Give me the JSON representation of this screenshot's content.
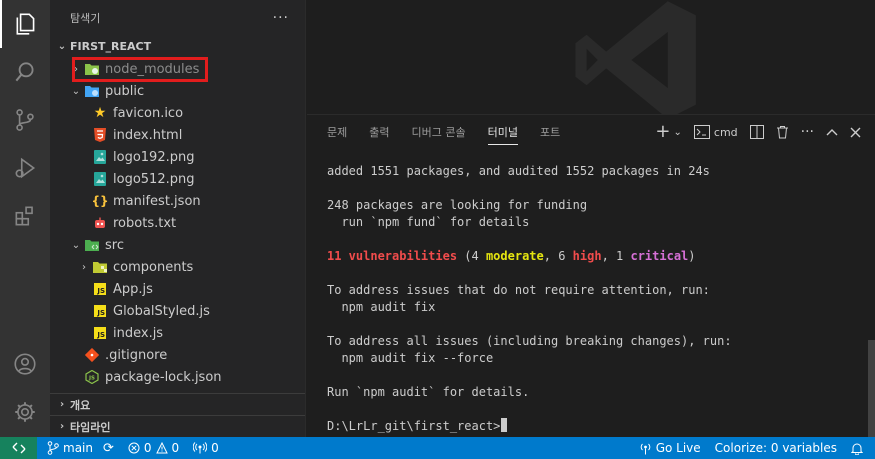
{
  "sidebar": {
    "title": "탐색기",
    "more_label": "···",
    "project": "FIRST_REACT",
    "tree": [
      {
        "label": "node_modules",
        "type": "folder",
        "icon": "node-folder-icon",
        "indent": 0,
        "chevron": "›",
        "top": 0
      },
      {
        "label": "public",
        "type": "folder",
        "icon": "public-folder-icon",
        "indent": 0,
        "chevron": "⌄"
      },
      {
        "label": "favicon.ico",
        "type": "file",
        "icon": "star-icon",
        "indent": 1
      },
      {
        "label": "index.html",
        "type": "file",
        "icon": "html5-icon",
        "indent": 1
      },
      {
        "label": "logo192.png",
        "type": "file",
        "icon": "image-icon",
        "indent": 1
      },
      {
        "label": "logo512.png",
        "type": "file",
        "icon": "image-icon",
        "indent": 1
      },
      {
        "label": "manifest.json",
        "type": "file",
        "icon": "json-icon",
        "indent": 1
      },
      {
        "label": "robots.txt",
        "type": "file",
        "icon": "robot-icon",
        "indent": 1
      },
      {
        "label": "src",
        "type": "folder",
        "icon": "src-folder-icon",
        "indent": 0,
        "chevron": "⌄"
      },
      {
        "label": "components",
        "type": "folder",
        "icon": "components-folder-icon",
        "indent": 1,
        "chevron": "›"
      },
      {
        "label": "App.js",
        "type": "file",
        "icon": "js-icon",
        "indent": 1
      },
      {
        "label": "GlobalStyled.js",
        "type": "file",
        "icon": "js-icon",
        "indent": 1
      },
      {
        "label": "index.js",
        "type": "file",
        "icon": "js-icon",
        "indent": 1
      },
      {
        "label": ".gitignore",
        "type": "file",
        "icon": "git-icon",
        "indent": 0
      },
      {
        "label": "package-lock.json",
        "type": "file",
        "icon": "npm-json-icon",
        "indent": 0
      }
    ],
    "outline_label": "개요",
    "timeline_label": "타임라인"
  },
  "panel": {
    "tabs": [
      "문제",
      "출력",
      "디버그 콘솔",
      "터미널",
      "포트"
    ],
    "active_tab": "터미널",
    "cmd_label": "cmd",
    "terminal": {
      "line1": "added 1551 packages, and audited 1552 packages in 24s",
      "line2": "248 packages are looking for funding",
      "line3": "  run `npm fund` for details",
      "vuln_count": "11 vulnerabilities",
      "vuln_open": " (4 ",
      "moderate": "moderate",
      "sep1": ", 6 ",
      "high": "high",
      "sep2": ", 1 ",
      "critical": "critical",
      "vuln_close": ")",
      "line5": "To address issues that do not require attention, run:",
      "line6": "  npm audit fix",
      "line7": "To address all issues (including breaking changes), run:",
      "line8": "  npm audit fix --force",
      "line9": "Run `npm audit` for details.",
      "prompt": "D:\\LrLr_git\\first_react>"
    }
  },
  "status": {
    "branch": "main",
    "errors": "0",
    "warnings": "0",
    "ports": "0",
    "golive": "Go Live",
    "colorize": "Colorize: 0 variables"
  },
  "colors": {
    "accent": "#007acc",
    "remote": "#16825d",
    "highlight": "#e21d1d"
  }
}
